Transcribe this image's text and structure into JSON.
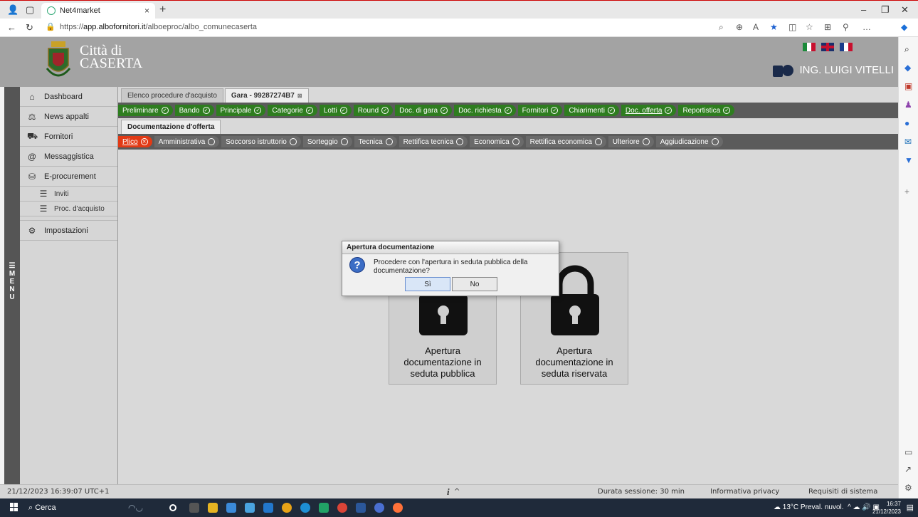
{
  "browser": {
    "tab_title": "Net4market",
    "tab_close": "×",
    "new_tab": "+",
    "url_prefix": "https://",
    "url_domain": "app.albofornitori.it",
    "url_path": "/alboeproc/albo_comunecaserta",
    "win_min": "–",
    "win_restore": "❐",
    "win_close": "✕"
  },
  "header": {
    "city_line1": "Città di",
    "city_line2": "CASERTA",
    "user_name": "ING. LUIGI VITELLI"
  },
  "menu_tab": "M E N U",
  "sidebar": {
    "items": [
      {
        "label": "Dashboard",
        "icon": "home-icon",
        "glyph": "⌂"
      },
      {
        "label": "News appalti",
        "icon": "scales-icon",
        "glyph": "⚖"
      },
      {
        "label": "Fornitori",
        "icon": "truck-icon",
        "glyph": "⛟"
      },
      {
        "label": "Messaggistica",
        "icon": "at-icon",
        "glyph": "@"
      },
      {
        "label": "E-procurement",
        "icon": "procurement-icon",
        "glyph": "⛁"
      }
    ],
    "subitems": [
      {
        "label": "Inviti",
        "icon": "list-icon",
        "glyph": "☰"
      },
      {
        "label": "Proc. d'acquisto",
        "icon": "list-icon",
        "glyph": "☰"
      }
    ],
    "settings": {
      "label": "Impostazioni",
      "icon": "gear-icon",
      "glyph": "⚙"
    }
  },
  "tabs": {
    "list": "Elenco procedure d'acquisto",
    "active": "Gara - 99287274B7"
  },
  "phases": [
    {
      "label": "Preliminare",
      "status": "done"
    },
    {
      "label": "Bando",
      "status": "done"
    },
    {
      "label": "Principale",
      "status": "done"
    },
    {
      "label": "Categorie",
      "status": "done"
    },
    {
      "label": "Lotti",
      "status": "done"
    },
    {
      "label": "Round",
      "status": "done"
    },
    {
      "label": "Doc. di gara",
      "status": "done"
    },
    {
      "label": "Doc. richiesta",
      "status": "done"
    },
    {
      "label": "Fornitori",
      "status": "done"
    },
    {
      "label": "Chiarimenti",
      "status": "done"
    },
    {
      "label": "Doc. offerta",
      "status": "done"
    },
    {
      "label": "Reportistica",
      "status": "done"
    }
  ],
  "doc_tab": "Documentazione d'offerta",
  "subphases": [
    {
      "label": "Plico",
      "status": "error"
    },
    {
      "label": "Amministrativa",
      "status": "pending"
    },
    {
      "label": "Soccorso istruttorio",
      "status": "pending"
    },
    {
      "label": "Sorteggio",
      "status": "pending"
    },
    {
      "label": "Tecnica",
      "status": "pending"
    },
    {
      "label": "Rettifica tecnica",
      "status": "pending"
    },
    {
      "label": "Economica",
      "status": "pending"
    },
    {
      "label": "Rettifica economica",
      "status": "pending"
    },
    {
      "label": "Ulteriore",
      "status": "pending"
    },
    {
      "label": "Aggiudicazione",
      "status": "pending"
    }
  ],
  "cards": {
    "public": {
      "l1": "Apertura",
      "l2": "documentazione in",
      "l3": "seduta pubblica"
    },
    "private": {
      "l1": "Apertura",
      "l2": "documentazione in",
      "l3": "seduta riservata"
    }
  },
  "dialog": {
    "title": "Apertura documentazione",
    "message": "Procedere con l'apertura in seduta pubblica della documentazione?",
    "yes": "Sì",
    "no": "No",
    "icon": "?"
  },
  "status": {
    "datetime": "21/12/2023 16:39:07 UTC+1",
    "info": "i",
    "session": "Durata sessione: 30 min",
    "privacy": "Informativa privacy",
    "requirements": "Requisiti di sistema"
  },
  "taskbar": {
    "search": "Cerca",
    "weather": "13°C  Preval. nuvol.",
    "time": "16:37",
    "date": "21/12/2023"
  },
  "colors": {
    "phase_done": "#2e7d1f",
    "phase_error": "#e23a15",
    "phase_pending": "#6a6a6a",
    "header_bg": "#a3a3a3"
  }
}
